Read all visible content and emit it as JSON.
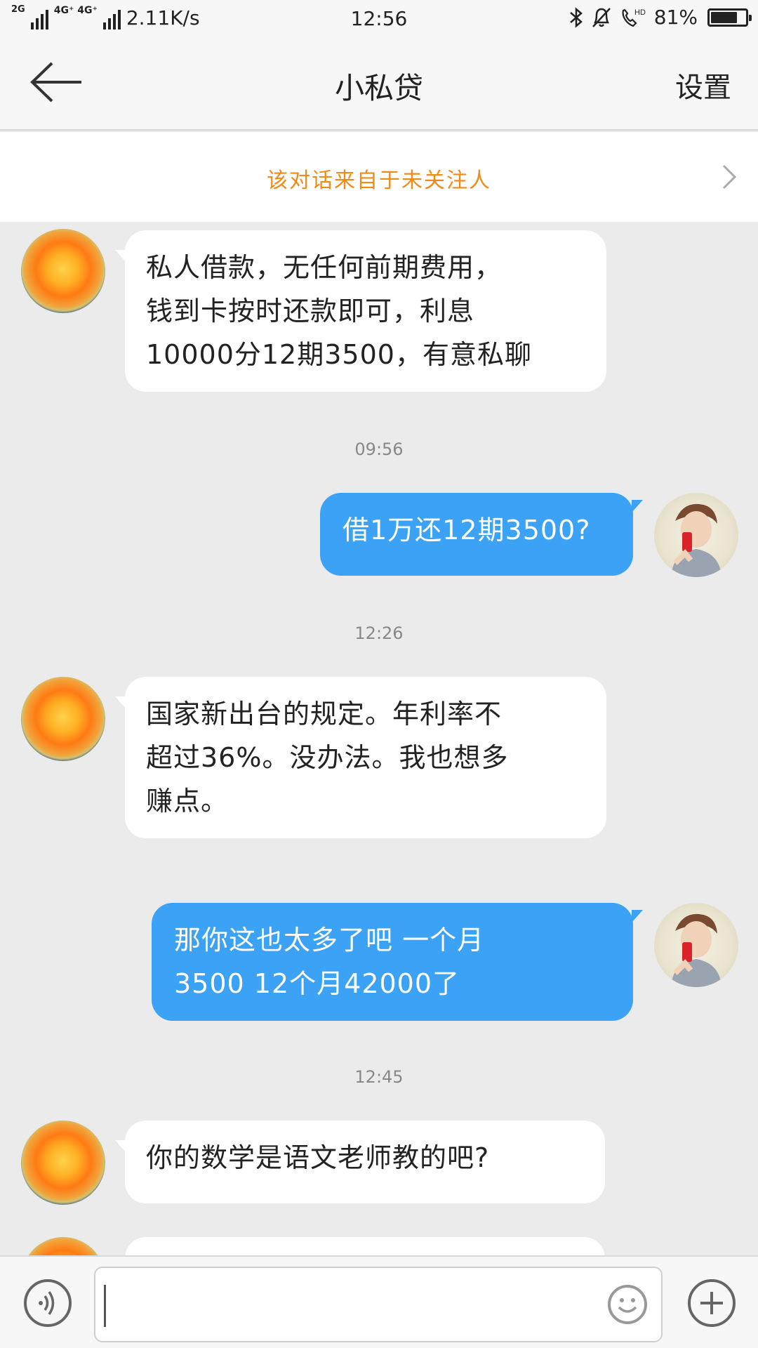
{
  "status_bar": {
    "network_gen": "2G",
    "network_4g": "4G⁺ 4G⁺",
    "speed": "2.11K/s",
    "time": "12:56",
    "battery": "81%",
    "battery_level": 0.81,
    "icons": [
      "bluetooth-icon",
      "mute-bell-icon",
      "hd-call-icon"
    ]
  },
  "nav": {
    "back_icon": "back-arrow-icon",
    "title": "小私贷",
    "settings": "设置"
  },
  "notice": {
    "text": "该对话来自于未关注人",
    "chevron_icon": "chevron-right-icon"
  },
  "messages": [
    {
      "from": "other",
      "lines": [
        "私人借款，无任何前期费用，",
        "钱到卡按时还款即可，利息",
        "10000分12期3500，有意私聊"
      ]
    },
    {
      "time": "09:56"
    },
    {
      "from": "me",
      "lines": [
        "借1万还12期3500?"
      ]
    },
    {
      "time": "12:26"
    },
    {
      "from": "other",
      "lines": [
        "国家新出台的规定。年利率不",
        "超过36%。没办法。我也想多",
        "赚点。"
      ]
    },
    {
      "from": "me",
      "lines": [
        "那你这也太多了吧  一个月",
        "3500  12个月42000了"
      ]
    },
    {
      "time": "12:45"
    },
    {
      "from": "other",
      "lines": [
        "你的数学是语文老师教的吧?"
      ]
    }
  ],
  "input_bar": {
    "voice_icon": "voice-icon",
    "input_value": "",
    "emoji_icon": "emoji-icon",
    "plus_icon": "plus-icon"
  },
  "colors": {
    "accent_out": "#3ba2f5",
    "notice": "#f08a18",
    "background": "#ebebeb"
  }
}
